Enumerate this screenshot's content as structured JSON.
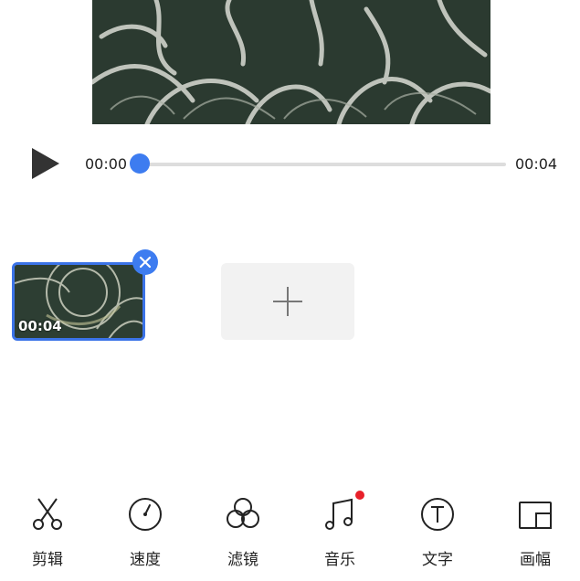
{
  "player": {
    "current_time": "00:00",
    "total_time": "00:04",
    "progress": 0
  },
  "clips": [
    {
      "duration": "00:04",
      "selected": true
    }
  ],
  "toolbar": {
    "items": [
      {
        "label": "剪辑",
        "icon": "scissors-icon"
      },
      {
        "label": "速度",
        "icon": "speedometer-icon"
      },
      {
        "label": "滤镜",
        "icon": "filter-circles-icon"
      },
      {
        "label": "音乐",
        "icon": "music-note-icon",
        "badge": true
      },
      {
        "label": "文字",
        "icon": "text-icon"
      },
      {
        "label": "画幅",
        "icon": "aspect-ratio-icon"
      }
    ]
  },
  "colors": {
    "accent": "#3d7cf0",
    "clip_border": "#3b73e8",
    "badge": "#e8202a",
    "icon_stroke": "#222222"
  }
}
